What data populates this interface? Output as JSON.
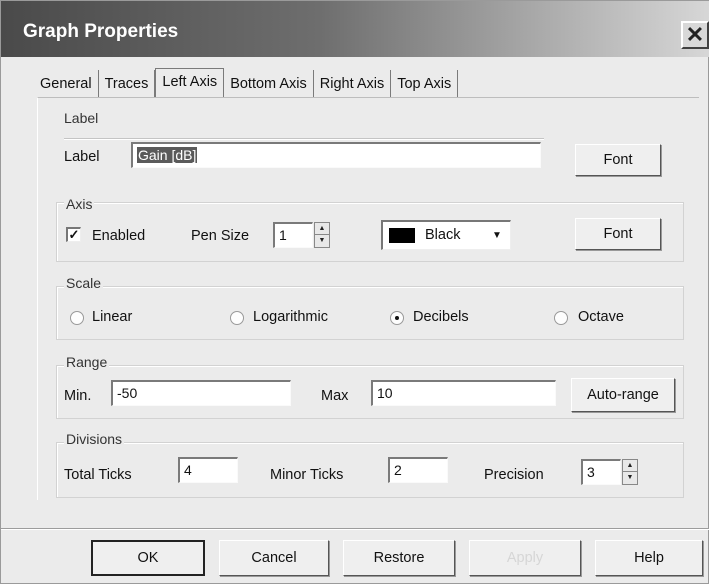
{
  "window": {
    "title": "Graph Properties",
    "close_glyph": "✕"
  },
  "tabs": [
    {
      "label": "General"
    },
    {
      "label": "Traces"
    },
    {
      "label": "Left Axis",
      "active": true
    },
    {
      "label": "Bottom Axis"
    },
    {
      "label": "Right Axis"
    },
    {
      "label": "Top Axis"
    }
  ],
  "label_group": {
    "title": "Label",
    "field_label": "Label",
    "value": "Gain [dB]",
    "font_button": "Font"
  },
  "axis_group": {
    "title": "Axis",
    "enabled_label": "Enabled",
    "enabled_checked": true,
    "check_glyph": "✓",
    "pen_size_label": "Pen Size",
    "pen_size_value": "1",
    "color_value": "Black",
    "color_swatch": "#000000",
    "font_button": "Font"
  },
  "scale_group": {
    "title": "Scale",
    "options": [
      "Linear",
      "Logarithmic",
      "Decibels",
      "Octave"
    ],
    "selected": "Decibels"
  },
  "range_group": {
    "title": "Range",
    "min_label": "Min.",
    "min_value": "-50",
    "max_label": "Max",
    "max_value": "10",
    "autorange_button": "Auto-range"
  },
  "divisions_group": {
    "title": "Divisions",
    "total_ticks_label": "Total Ticks",
    "total_ticks_value": "4",
    "minor_ticks_label": "Minor Ticks",
    "minor_ticks_value": "2",
    "precision_label": "Precision",
    "precision_value": "3"
  },
  "footer": {
    "ok": "OK",
    "cancel": "Cancel",
    "restore": "Restore",
    "apply": "Apply",
    "help": "Help"
  },
  "icons": {
    "spin_up": "▲",
    "spin_down": "▼",
    "dropdown": "▼"
  }
}
